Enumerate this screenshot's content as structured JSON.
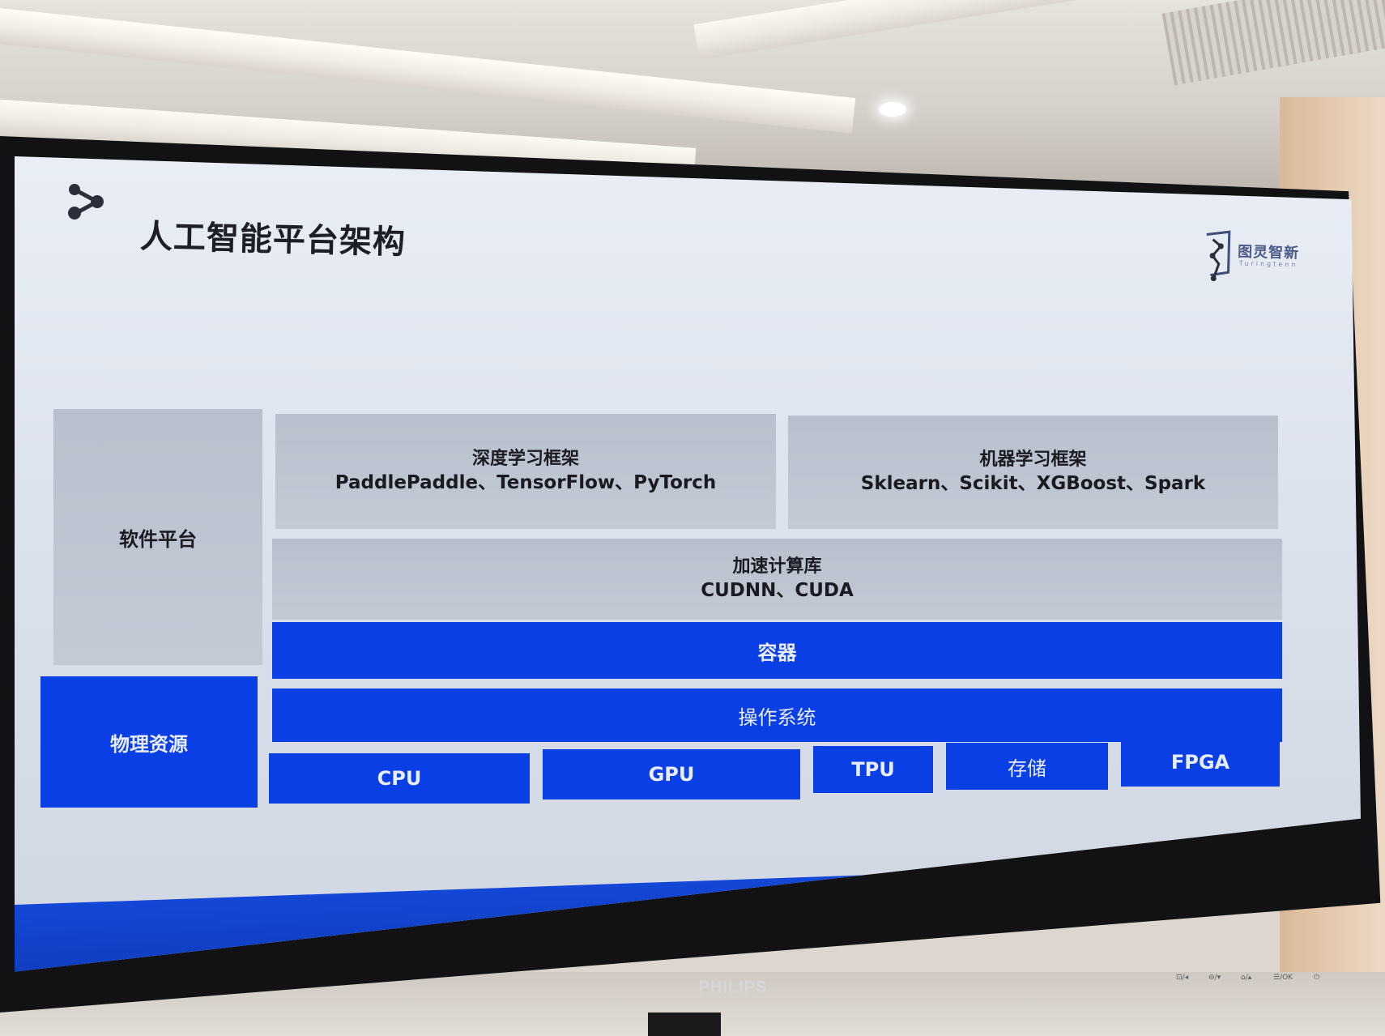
{
  "slide": {
    "title": "人工智能平台架构",
    "company_logo_text": "图灵智新",
    "company_logo_subtext": "Turingtenn"
  },
  "architecture": {
    "software_platform_label": "软件平台",
    "physical_resources_label": "物理资源",
    "deep_learning": {
      "title": "深度学习框架",
      "frameworks": "PaddlePaddle、TensorFlow、PyTorch"
    },
    "machine_learning": {
      "title": "机器学习框架",
      "frameworks": "Sklearn、Scikit、XGBoost、Spark"
    },
    "acceleration": {
      "title": "加速计算库",
      "libraries": "CUDNN、CUDA"
    },
    "container_label": "容器",
    "os_label": "操作系统",
    "hardware": [
      "CPU",
      "GPU",
      "TPU",
      "存储",
      "FPGA"
    ]
  },
  "monitor": {
    "brand": "PHILIPS",
    "buttons": [
      "⊡/◂",
      "⊖/▾",
      "⌂/▴",
      "☰/OK",
      "⏻"
    ]
  },
  "colors": {
    "accent_blue": "#0b3fe6",
    "panel_gray": "#bcc3cf",
    "footer_blue": "#1447d6"
  },
  "icons": [
    "share-nodes-icon",
    "company-logo-icon",
    "power-icon"
  ]
}
